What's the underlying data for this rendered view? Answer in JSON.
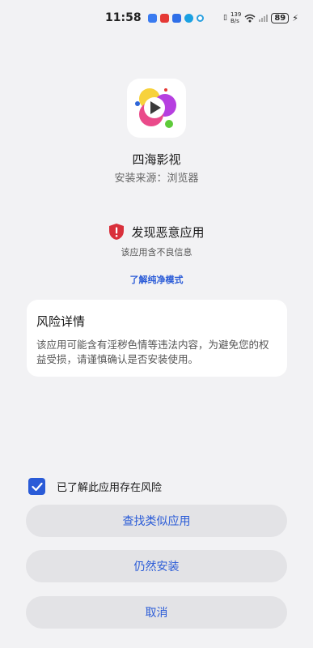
{
  "status_bar": {
    "time": "11:58",
    "net_speed_value": "139",
    "net_speed_unit": "B/s",
    "battery": "89"
  },
  "app": {
    "name": "四海影视",
    "source": "安装来源：浏览器"
  },
  "warning": {
    "title": "发现恶意应用",
    "subtitle": "该应用含不良信息",
    "learn_link": "了解纯净模式"
  },
  "risk_card": {
    "title": "风险详情",
    "text": "该应用可能含有淫秽色情等违法内容，为避免您的权益受损，请谨慎确认是否安装使用。"
  },
  "acknowledge": {
    "label": "已了解此应用存在风险",
    "checked": true
  },
  "buttons": {
    "find_similar": "查找类似应用",
    "install_anyway": "仍然安装",
    "cancel": "取消"
  },
  "colors": {
    "accent": "#2a5bd7",
    "danger": "#d9303b",
    "background": "#f2f2f4"
  }
}
